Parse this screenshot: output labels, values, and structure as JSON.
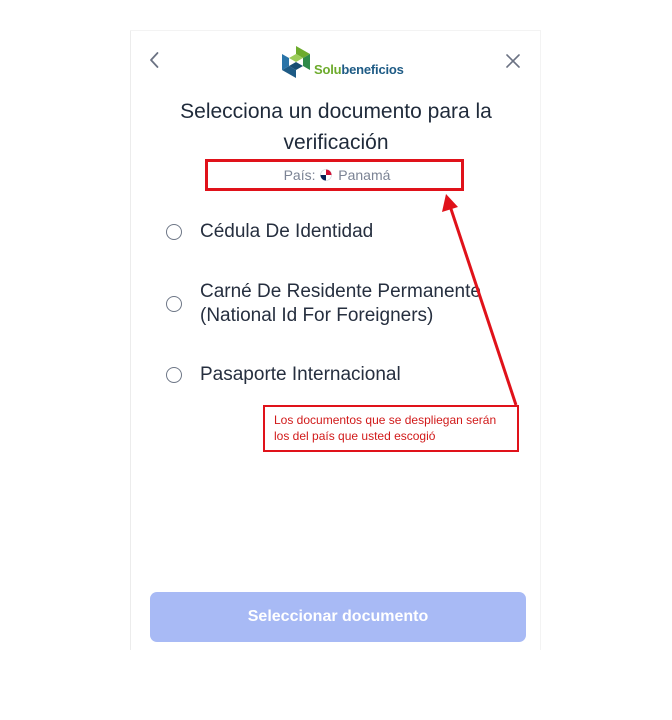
{
  "brand": {
    "name_part1": "Solu",
    "name_part2": "beneficios",
    "color_green": "#6dab2c",
    "color_blue": "#1e5b85"
  },
  "header": {
    "back_icon": "chevron-left-icon",
    "close_icon": "close-icon"
  },
  "title": "Selecciona un documento para la verificación",
  "country": {
    "label": "País:",
    "name": "Panamá",
    "flag_icon": "panama-flag-icon"
  },
  "documents": [
    {
      "label": "Cédula De Identidad",
      "selected": false
    },
    {
      "label": "Carné De Residente Permanente (National Id For Foreigners)",
      "selected": false
    },
    {
      "label": "Pasaporte Internacional",
      "selected": false
    }
  ],
  "annotation": {
    "text": "Los documentos que se despliegan serán los del país que usted escogió",
    "color": "#e0121a"
  },
  "actions": {
    "select_label": "Seleccionar documento",
    "enabled": false,
    "color": "#a8baf5"
  }
}
